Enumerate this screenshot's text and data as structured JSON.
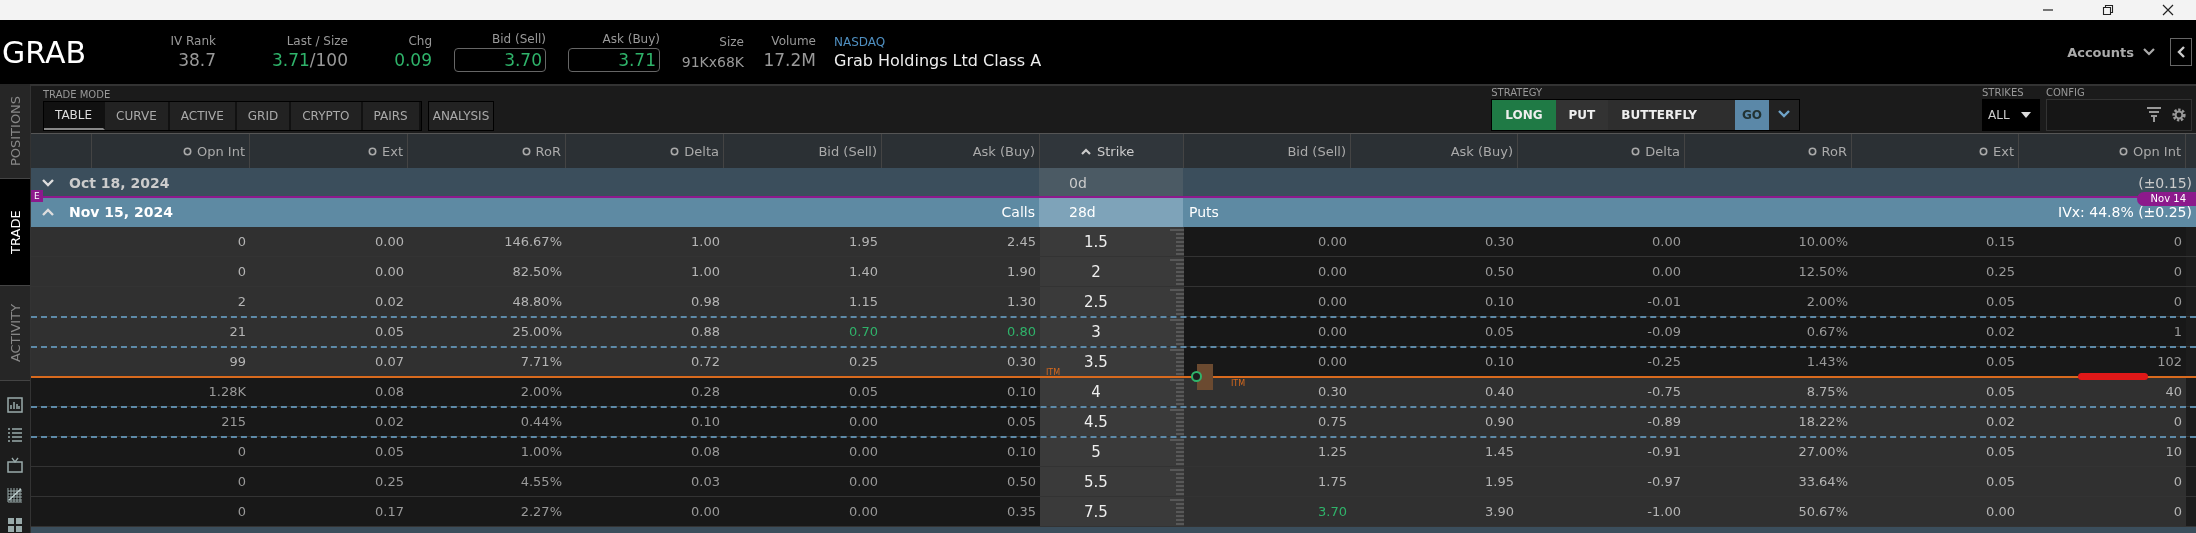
{
  "quote": {
    "symbol": "GRAB",
    "iv_rank": {
      "label": "IV Rank",
      "value": "38.7"
    },
    "last": {
      "label": "Last / Size",
      "price": "3.71",
      "size": "/100"
    },
    "chg": {
      "label": "Chg",
      "value": "0.09"
    },
    "bid": {
      "label": "Bid (Sell)",
      "value": "3.70"
    },
    "ask": {
      "label": "Ask (Buy)",
      "value": "3.71"
    },
    "size": {
      "label": "Size",
      "value": "91Kx68K"
    },
    "volume": {
      "label": "Volume",
      "value": "17.2M"
    },
    "exchange": "NASDAQ",
    "name": "Grab Holdings Ltd Class A"
  },
  "accounts": "Accounts",
  "sidebar_tabs": [
    {
      "label": "POSITIONS",
      "selected": false
    },
    {
      "label": "TRADE",
      "selected": true
    },
    {
      "label": "ACTIVITY",
      "selected": false
    }
  ],
  "trade_mode": {
    "label": "TRADE MODE",
    "tabs": [
      {
        "label": "TABLE",
        "selected": true
      },
      {
        "label": "CURVE",
        "selected": false
      },
      {
        "label": "ACTIVE",
        "selected": false
      },
      {
        "label": "GRID",
        "selected": false
      },
      {
        "label": "CRYPTO",
        "selected": false
      },
      {
        "label": "PAIRS",
        "selected": false
      }
    ],
    "extra_tab": "ANALYSIS"
  },
  "strategy": {
    "label": "STRATEGY",
    "buttons": [
      {
        "label": "LONG",
        "kind": "side"
      },
      {
        "label": "PUT",
        "kind": "type"
      },
      {
        "label": "BUTTERFLY",
        "kind": "strategy"
      },
      {
        "label": "GO",
        "kind": "go"
      }
    ]
  },
  "strikes": {
    "label": "STRIKES",
    "value": "ALL"
  },
  "config": {
    "label": "CONFIG"
  },
  "table": {
    "call_columns": [
      {
        "label": "Opn Int",
        "kind": "toggle"
      },
      {
        "label": "Ext",
        "kind": "toggle"
      },
      {
        "label": "RoR",
        "kind": "toggle"
      },
      {
        "label": "Delta",
        "kind": "toggle"
      },
      {
        "label": "Bid (Sell)",
        "kind": "plain"
      },
      {
        "label": "Ask (Buy)",
        "kind": "plain"
      }
    ],
    "strike_column": "Strike",
    "put_columns": [
      {
        "label": "Bid (Sell)",
        "kind": "plain"
      },
      {
        "label": "Ask (Buy)",
        "kind": "plain"
      },
      {
        "label": "Delta",
        "kind": "toggle"
      },
      {
        "label": "RoR",
        "kind": "toggle"
      },
      {
        "label": "Ext",
        "kind": "toggle"
      },
      {
        "label": "Opn Int",
        "kind": "toggle"
      }
    ],
    "expirations": [
      {
        "date": "Oct 18, 2024",
        "expanded": false,
        "days": "0d",
        "right": "(±0.15)"
      },
      {
        "date": "Nov 15, 2024",
        "expanded": true,
        "calls_label": "Calls",
        "days": "28d",
        "puts_label": "Puts",
        "right": "IVx: 44.8% (±0.25)"
      }
    ],
    "earnings": {
      "marker": "E",
      "tag": "Nov 14"
    },
    "rows": [
      {
        "strike": "1.5",
        "calls": [
          "0",
          "0.00",
          "146.67%",
          "1.00",
          "1.95",
          "2.45"
        ],
        "puts": [
          "0.00",
          "0.30",
          "0.00",
          "10.00%",
          "0.15",
          "0"
        ],
        "call_itm": true,
        "put_itm": false,
        "call_bid_up": false,
        "call_ask_up": false,
        "put_bid_up": false,
        "dashed_below": false,
        "itm_below": false,
        "marked": false
      },
      {
        "strike": "2",
        "calls": [
          "0",
          "0.00",
          "82.50%",
          "1.00",
          "1.40",
          "1.90"
        ],
        "puts": [
          "0.00",
          "0.50",
          "0.00",
          "12.50%",
          "0.25",
          "0"
        ],
        "call_itm": true,
        "put_itm": false,
        "call_bid_up": false,
        "call_ask_up": false,
        "put_bid_up": false,
        "dashed_below": false,
        "itm_below": false,
        "marked": false
      },
      {
        "strike": "2.5",
        "calls": [
          "2",
          "0.02",
          "48.80%",
          "0.98",
          "1.15",
          "1.30"
        ],
        "puts": [
          "0.00",
          "0.10",
          "-0.01",
          "2.00%",
          "0.05",
          "0"
        ],
        "call_itm": true,
        "put_itm": false,
        "call_bid_up": false,
        "call_ask_up": false,
        "put_bid_up": false,
        "dashed_below": true,
        "itm_below": false,
        "marked": false
      },
      {
        "strike": "3",
        "calls": [
          "21",
          "0.05",
          "25.00%",
          "0.88",
          "0.70",
          "0.80"
        ],
        "puts": [
          "0.00",
          "0.05",
          "-0.09",
          "0.67%",
          "0.02",
          "1"
        ],
        "call_itm": true,
        "put_itm": false,
        "call_bid_up": true,
        "call_ask_up": true,
        "put_bid_up": false,
        "dashed_below": true,
        "itm_below": false,
        "marked": false
      },
      {
        "strike": "3.5",
        "calls": [
          "99",
          "0.07",
          "7.71%",
          "0.72",
          "0.25",
          "0.30"
        ],
        "puts": [
          "0.00",
          "0.10",
          "-0.25",
          "1.43%",
          "0.05",
          "102"
        ],
        "call_itm": true,
        "put_itm": false,
        "call_bid_up": false,
        "call_ask_up": false,
        "put_bid_up": false,
        "dashed_below": false,
        "itm_below": true,
        "itm_call_label": "ITM",
        "itm_put_label": "ITM",
        "marked": true
      },
      {
        "strike": "4",
        "calls": [
          "1.28K",
          "0.08",
          "2.00%",
          "0.28",
          "0.05",
          "0.10"
        ],
        "puts": [
          "0.30",
          "0.40",
          "-0.75",
          "8.75%",
          "0.05",
          "40"
        ],
        "call_itm": false,
        "put_itm": true,
        "call_bid_up": false,
        "call_ask_up": false,
        "put_bid_up": false,
        "dashed_below": true,
        "itm_below": false,
        "marked": false
      },
      {
        "strike": "4.5",
        "calls": [
          "215",
          "0.02",
          "0.44%",
          "0.10",
          "0.00",
          "0.05"
        ],
        "puts": [
          "0.75",
          "0.90",
          "-0.89",
          "18.22%",
          "0.02",
          "0"
        ],
        "call_itm": false,
        "put_itm": true,
        "call_bid_up": false,
        "call_ask_up": false,
        "put_bid_up": false,
        "dashed_below": true,
        "itm_below": false,
        "marked": false
      },
      {
        "strike": "5",
        "calls": [
          "0",
          "0.05",
          "1.00%",
          "0.08",
          "0.00",
          "0.10"
        ],
        "puts": [
          "1.25",
          "1.45",
          "-0.91",
          "27.00%",
          "0.05",
          "10"
        ],
        "call_itm": false,
        "put_itm": true,
        "call_bid_up": false,
        "call_ask_up": false,
        "put_bid_up": false,
        "dashed_below": false,
        "itm_below": false,
        "marked": false
      },
      {
        "strike": "5.5",
        "calls": [
          "0",
          "0.25",
          "4.55%",
          "0.03",
          "0.00",
          "0.50"
        ],
        "puts": [
          "1.75",
          "1.95",
          "-0.97",
          "33.64%",
          "0.05",
          "0"
        ],
        "call_itm": false,
        "put_itm": true,
        "call_bid_up": false,
        "call_ask_up": false,
        "put_bid_up": false,
        "dashed_below": false,
        "itm_below": false,
        "marked": false
      },
      {
        "strike": "7.5",
        "calls": [
          "0",
          "0.17",
          "2.27%",
          "0.00",
          "0.00",
          "0.35"
        ],
        "puts": [
          "3.70",
          "3.90",
          "-1.00",
          "50.67%",
          "0.00",
          "0"
        ],
        "call_itm": false,
        "put_itm": true,
        "call_bid_up": false,
        "call_ask_up": false,
        "put_bid_up": true,
        "dashed_below": false,
        "itm_below": false,
        "marked": false
      }
    ]
  }
}
